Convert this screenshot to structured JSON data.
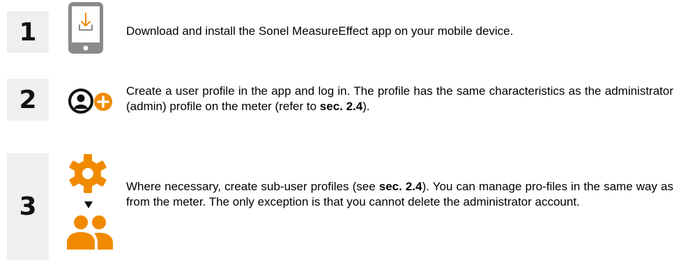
{
  "steps": [
    {
      "number": "1",
      "text": "Download and install the Sonel MeasureEffect app on your mobile device."
    },
    {
      "number": "2",
      "text_before": "Create a user profile in the app and log in. The profile has the same characteristics as the administrator (admin) profile on the meter (refer to ",
      "ref": "sec. 2.4",
      "text_after": ")."
    },
    {
      "number": "3",
      "text_before": "Where necessary, create sub-user profiles (see ",
      "ref": "sec. 2.4",
      "text_after": "). You can manage pro-files in the same way as from the meter. The only exception is that you cannot delete the administrator account."
    }
  ],
  "icons": {
    "step1": "phone-download-icon",
    "step2": [
      "user-icon",
      "plus-icon"
    ],
    "step3": [
      "gear-icon",
      "arrow-down-icon",
      "users-icon"
    ]
  },
  "colors": {
    "accent": "#f08a00",
    "phone_grey": "#8a8a8a",
    "number_box_bg": "#efefef"
  }
}
